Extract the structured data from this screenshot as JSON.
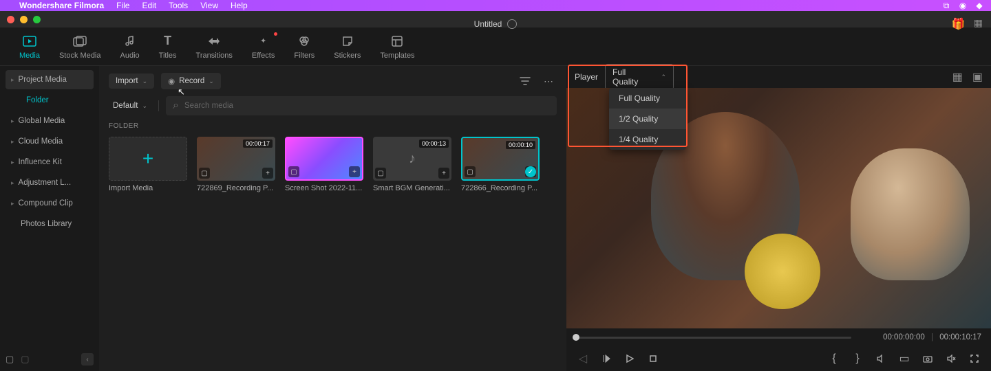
{
  "menubar": {
    "app_name": "Wondershare Filmora",
    "menus": [
      "File",
      "Edit",
      "Tools",
      "View",
      "Help"
    ]
  },
  "titlebar": {
    "title": "Untitled"
  },
  "main_tabs": [
    {
      "label": "Media",
      "icon": "media-icon",
      "active": true
    },
    {
      "label": "Stock Media",
      "icon": "stock-icon"
    },
    {
      "label": "Audio",
      "icon": "audio-icon"
    },
    {
      "label": "Titles",
      "icon": "titles-icon"
    },
    {
      "label": "Transitions",
      "icon": "transitions-icon"
    },
    {
      "label": "Effects",
      "icon": "effects-icon",
      "badge": true
    },
    {
      "label": "Filters",
      "icon": "filters-icon"
    },
    {
      "label": "Stickers",
      "icon": "stickers-icon"
    },
    {
      "label": "Templates",
      "icon": "templates-icon"
    }
  ],
  "sidebar": {
    "items": [
      {
        "label": "Project Media",
        "active": true,
        "sub": "Folder"
      },
      {
        "label": "Global Media"
      },
      {
        "label": "Cloud Media"
      },
      {
        "label": "Influence Kit"
      },
      {
        "label": "Adjustment L..."
      },
      {
        "label": "Compound Clip"
      },
      {
        "label": "Photos Library"
      }
    ]
  },
  "media_toolbar": {
    "import_label": "Import",
    "record_label": "Record",
    "sort_label": "Default",
    "search_placeholder": "Search media"
  },
  "media_section": {
    "label": "FOLDER",
    "import_label": "Import Media",
    "items": [
      {
        "name": "722869_Recording P...",
        "duration": "00:00:17",
        "thumb": "podcast"
      },
      {
        "name": "Screen Shot 2022-11...",
        "duration": "",
        "thumb": "screenshot",
        "pink_border": true
      },
      {
        "name": "Smart BGM Generati...",
        "duration": "00:00:13",
        "thumb": "audio"
      },
      {
        "name": "722866_Recording P...",
        "duration": "00:00:10",
        "thumb": "podcast",
        "selected": true,
        "check": true
      }
    ]
  },
  "preview": {
    "player_label": "Player",
    "quality_selected": "Full Quality",
    "quality_options": [
      "Full Quality",
      "1/2 Quality",
      "1/4 Quality"
    ],
    "time_current": "00:00:00:00",
    "time_total": "00:00:10:17"
  }
}
